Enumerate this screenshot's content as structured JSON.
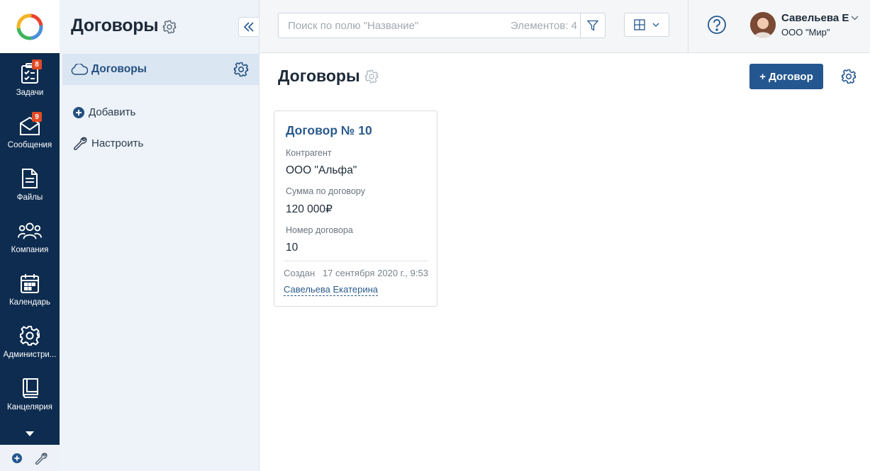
{
  "rail": {
    "items": [
      {
        "label": "Задачи",
        "icon": "tasks-icon",
        "badge": "8"
      },
      {
        "label": "Сообщения",
        "icon": "messages-icon",
        "badge": "9"
      },
      {
        "label": "Файлы",
        "icon": "files-icon",
        "badge": ""
      },
      {
        "label": "Компания",
        "icon": "company-icon",
        "badge": ""
      },
      {
        "label": "Календарь",
        "icon": "calendar-icon",
        "badge": ""
      },
      {
        "label": "Администри...",
        "icon": "gear-icon",
        "badge": ""
      },
      {
        "label": "Канцелярия",
        "icon": "book-icon",
        "badge": ""
      }
    ]
  },
  "sidebar": {
    "title": "Договоры",
    "active_item": "Договоры",
    "add_label": "Добавить",
    "configure_label": "Настроить"
  },
  "topbar": {
    "search_placeholder": "Поиск по полю \"Название\"",
    "count_label": "Элементов: 4",
    "user_name": "Савельева Е",
    "user_org": "ООО \"Мир\""
  },
  "main": {
    "title": "Договоры",
    "add_button": "+ Договор"
  },
  "card": {
    "title": "Договор № 10",
    "fields": [
      {
        "label": "Контрагент",
        "value": "ООО \"Альфа\""
      },
      {
        "label": "Сумма по договору",
        "value": "120 000₽"
      },
      {
        "label": "Номер договора",
        "value": "10"
      }
    ],
    "created": "Создан   17 сентября 2020 г., 9:53",
    "author": "Савельева Екатерина"
  },
  "colors": {
    "rail_bg": "#0d2c4f",
    "sidebar_bg": "#eef3fa",
    "accent": "#24578f",
    "badge": "#e14b25"
  }
}
